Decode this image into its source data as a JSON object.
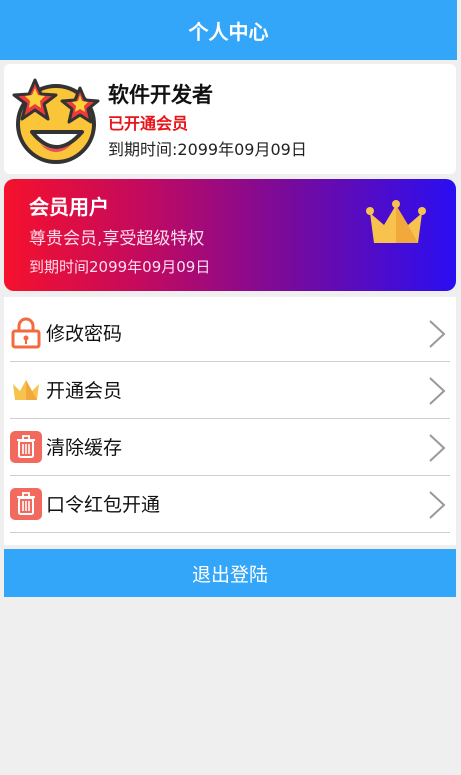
{
  "header": {
    "title": "个人中心"
  },
  "profile": {
    "name": "软件开发者",
    "member_status": "已开通会员",
    "expire_text": "到期时间:2099年09月09日",
    "avatar_icon": "star-struck-emoji-icon"
  },
  "vip_card": {
    "title": "会员用户",
    "subtitle": "尊贵会员,享受超级特权",
    "expire_text": "到期时间2099年09月09日",
    "icon": "crown-icon",
    "gradient_colors": [
      "#f5112c",
      "#c40a5e",
      "#7a0a9a",
      "#2a0ef2"
    ]
  },
  "menu": {
    "items": [
      {
        "label": "修改密码",
        "icon": "lock-icon"
      },
      {
        "label": "开通会员",
        "icon": "crown-icon"
      },
      {
        "label": "清除缓存",
        "icon": "trash-icon"
      },
      {
        "label": "口令红包开通",
        "icon": "trash-icon"
      }
    ]
  },
  "logout": {
    "label": "退出登陆"
  },
  "colors": {
    "accent": "#33a6fa",
    "member_red": "#e8141a",
    "icon_orange": "#f26a3d",
    "crown_gold": "#f7c34d"
  }
}
